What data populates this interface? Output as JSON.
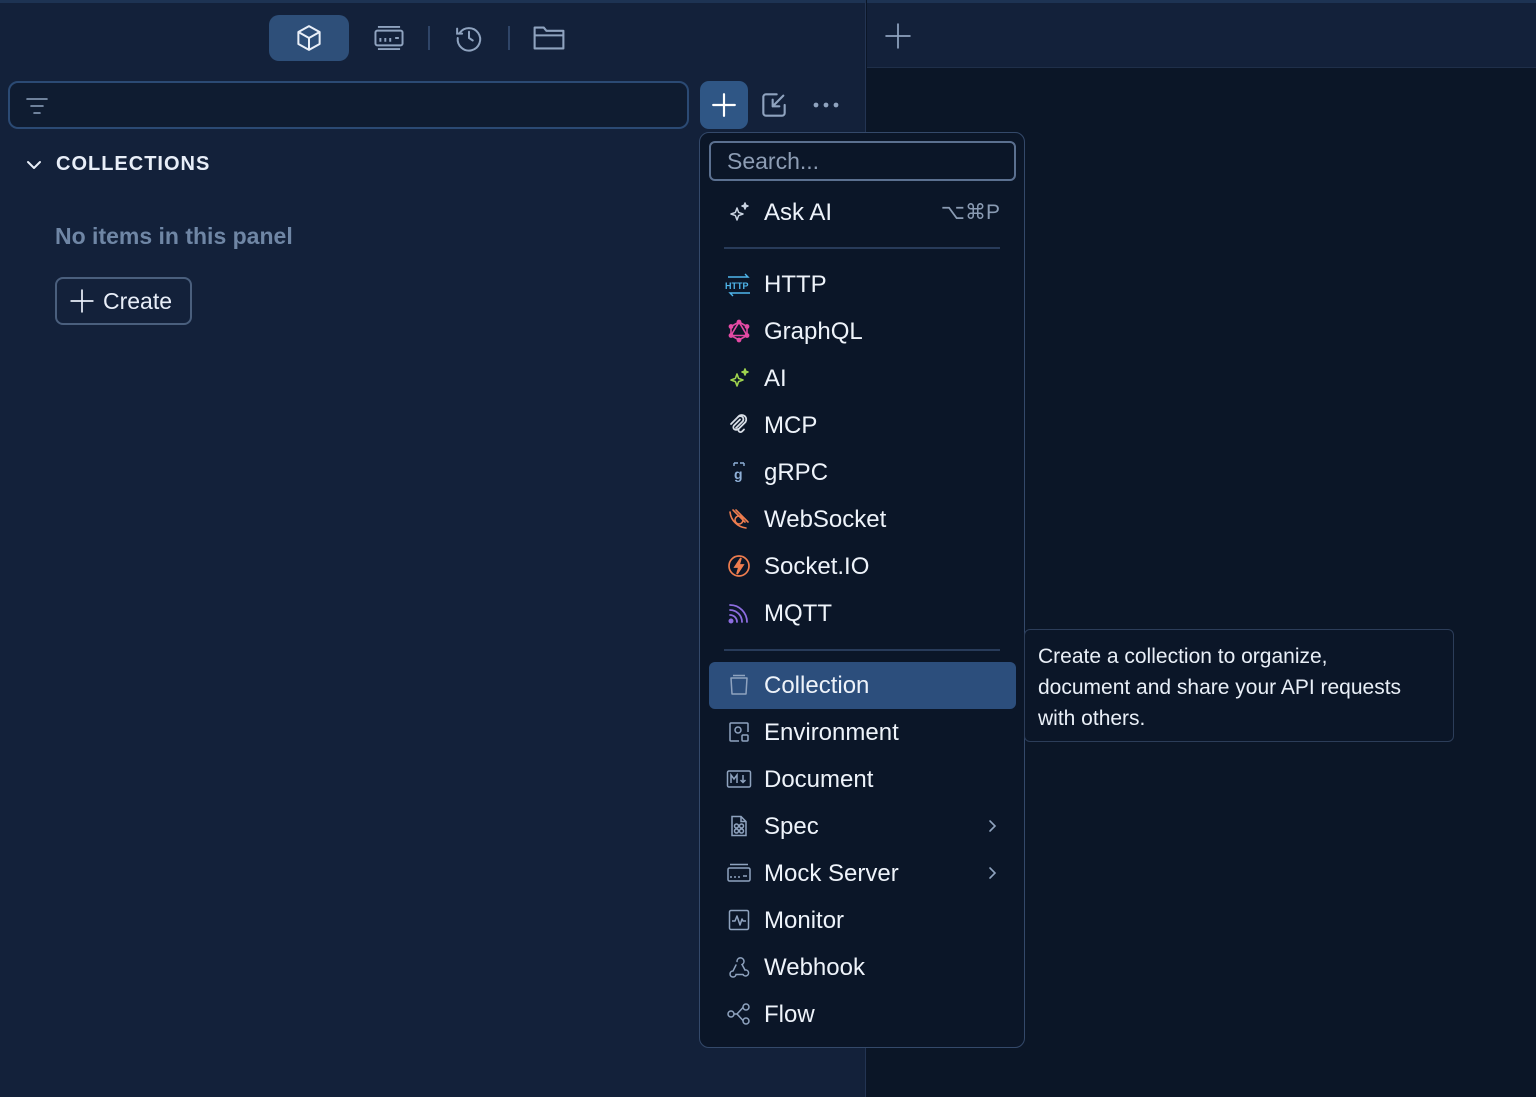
{
  "sidebar": {
    "toolbar": {
      "items": [
        {
          "name": "collections-tab",
          "icon": "cube-icon",
          "active": true
        },
        {
          "name": "mock-servers-tab",
          "icon": "server-icon",
          "active": false
        },
        {
          "name": "history-tab",
          "icon": "history-icon",
          "active": false
        },
        {
          "name": "files-tab",
          "icon": "folder-icon",
          "active": false
        }
      ]
    },
    "filter": {
      "placeholder": "",
      "value": ""
    },
    "section": {
      "title": "COLLECTIONS",
      "empty_text": "No items in this panel",
      "create_label": "Create"
    }
  },
  "menu": {
    "search_placeholder": "Search...",
    "ask_ai": {
      "label": "Ask AI",
      "shortcut": "⌥⌘P"
    },
    "request_types": [
      {
        "label": "HTTP",
        "icon": "http-icon",
        "color": "#4fb6ec"
      },
      {
        "label": "GraphQL",
        "icon": "graphql-icon",
        "color": "#e44aa4"
      },
      {
        "label": "AI",
        "icon": "ai-sparkle-icon",
        "color": "#9fd34e"
      },
      {
        "label": "MCP",
        "icon": "mcp-icon",
        "color": "#d7dde6"
      },
      {
        "label": "gRPC",
        "icon": "grpc-icon",
        "color": "#8fb0d8"
      },
      {
        "label": "WebSocket",
        "icon": "websocket-icon",
        "color": "#ef7d4f"
      },
      {
        "label": "Socket.IO",
        "icon": "socketio-icon",
        "color": "#ef7d4f"
      },
      {
        "label": "MQTT",
        "icon": "mqtt-icon",
        "color": "#8d6de0"
      }
    ],
    "entities": [
      {
        "label": "Collection",
        "icon": "collection-icon",
        "selected": true
      },
      {
        "label": "Environment",
        "icon": "environment-icon"
      },
      {
        "label": "Document",
        "icon": "markdown-document-icon"
      },
      {
        "label": "Spec",
        "icon": "spec-icon",
        "has_submenu": true
      },
      {
        "label": "Mock Server",
        "icon": "mock-server-icon",
        "has_submenu": true
      },
      {
        "label": "Monitor",
        "icon": "monitor-icon"
      },
      {
        "label": "Webhook",
        "icon": "webhook-icon"
      },
      {
        "label": "Flow",
        "icon": "flow-icon"
      }
    ]
  },
  "tooltip": {
    "lines": [
      "Create a collection to organize,",
      "document and share your API requests",
      "with others."
    ]
  },
  "colors": {
    "accent": "#2f5685",
    "selected": "#2c4e7c",
    "sidebar_bg": "#13213a",
    "main_bg": "#0b1627"
  }
}
